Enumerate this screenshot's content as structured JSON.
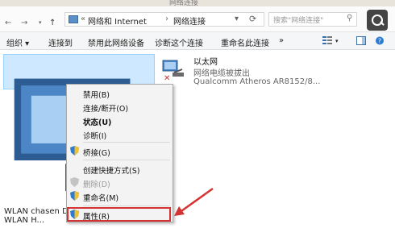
{
  "window": {
    "title": "网络连接"
  },
  "address_bar": {
    "back": "←",
    "forward": "→",
    "up": "↑",
    "overflow": "«",
    "crumbs": [
      "网络和 Internet",
      "网络连接"
    ],
    "separator": "›",
    "search_placeholder": "搜索\"网络连接\""
  },
  "toolbar": {
    "organize": "组织 ▾",
    "connect_to": "连接到",
    "disable_device": "禁用此网络设备",
    "diagnose": "诊断这个连接",
    "rename": "重命名此连接",
    "more": "»"
  },
  "adapters": [
    {
      "name": "WLAN",
      "status": "chasen",
      "device": "DW1501 Wireless-N WLAN H..."
    },
    {
      "name": "以太网",
      "status": "网络电缆被拔出",
      "device": "Qualcomm Atheros AR8152/8..."
    }
  ],
  "context_menu": {
    "items": [
      {
        "label": "禁用(B)"
      },
      {
        "label": "连接/断开(O)"
      },
      {
        "label": "状态(U)"
      },
      {
        "label": "诊断(I)"
      },
      {
        "label": "桥接(G)"
      },
      {
        "label": "创建快捷方式(S)"
      },
      {
        "label": "删除(D)"
      },
      {
        "label": "重命名(M)"
      },
      {
        "label": "属性(R)"
      }
    ]
  },
  "colors": {
    "highlight": "#d43333",
    "selection": "#cde8ff",
    "accent": "#2b7bd3"
  }
}
